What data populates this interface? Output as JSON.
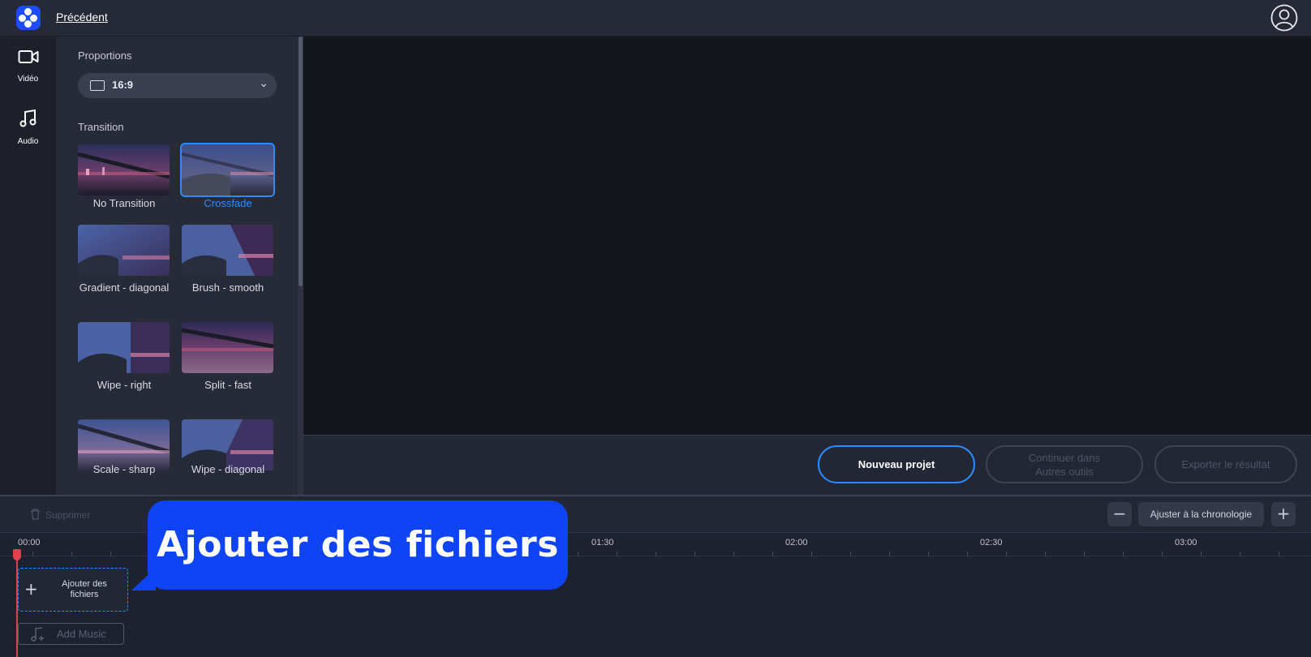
{
  "header": {
    "back_label": "Précédent"
  },
  "rail": {
    "items": [
      {
        "label": "Vidéo",
        "icon": "video-camera-icon"
      },
      {
        "label": "Audio",
        "icon": "music-note-icon"
      }
    ]
  },
  "panel": {
    "proportions_label": "Proportions",
    "ratio_value": "16:9",
    "transition_label": "Transition",
    "transitions": [
      {
        "label": "No Transition",
        "selected": false
      },
      {
        "label": "Crossfade",
        "selected": true
      },
      {
        "label": "Gradient - diagonal",
        "selected": false
      },
      {
        "label": "Brush - smooth",
        "selected": false
      },
      {
        "label": "Wipe - right",
        "selected": false
      },
      {
        "label": "Split - fast",
        "selected": false
      },
      {
        "label": "Scale - sharp",
        "selected": false
      },
      {
        "label": "Wipe - diagonal",
        "selected": false
      }
    ]
  },
  "actions": {
    "new_project": "Nouveau projet",
    "continue_other": "Continuer dans Autres outils",
    "export": "Exporter le résultat"
  },
  "timeline_toolbar": {
    "delete_label": "Supprimer",
    "zoom_out": "−",
    "fit_label": "Ajuster à la chronologie",
    "zoom_in": "+"
  },
  "timeline": {
    "time_labels": [
      "00:00",
      "01:30",
      "02:00",
      "02:30",
      "03:00"
    ],
    "add_files_label": "Ajouter des fichiers",
    "add_music_label": "Add Music"
  },
  "callout": {
    "text": "Ajouter des fichiers"
  },
  "colors": {
    "accent": "#2b8cff",
    "callout": "#0e44f4",
    "playhead": "#e0414c"
  }
}
